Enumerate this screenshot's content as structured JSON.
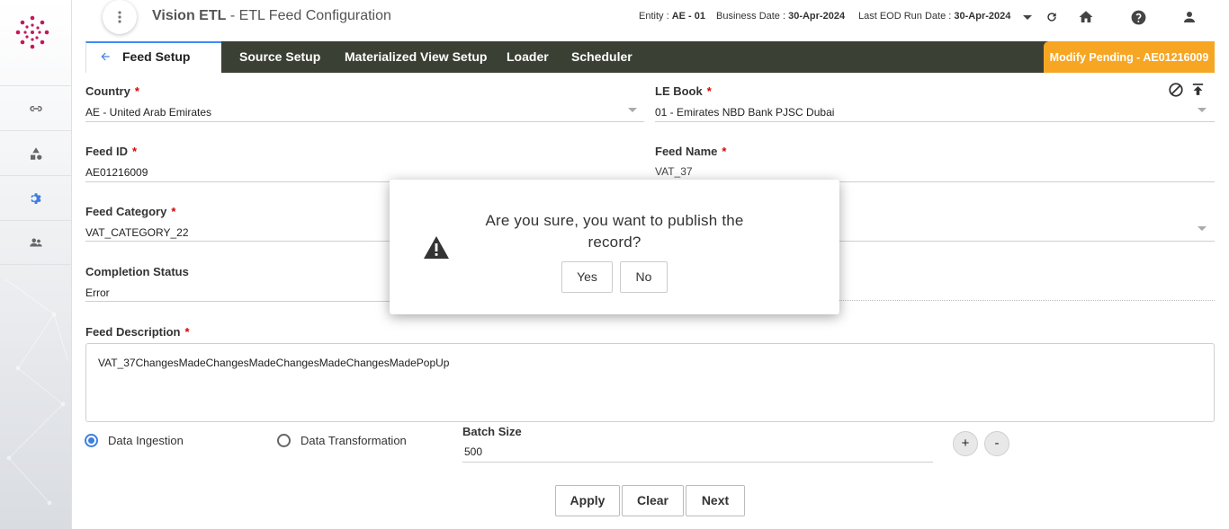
{
  "app": {
    "title_bold": "Vision ETL",
    "title_rest": " - ETL Feed Configuration"
  },
  "header": {
    "entity_label": "Entity : ",
    "entity_value": "AE - 01",
    "business_date_label": "Business Date : ",
    "business_date_value": "30-Apr-2024",
    "last_eod_label": "Last EOD Run Date : ",
    "last_eod_value": "30-Apr-2024"
  },
  "tabs": [
    {
      "label": "Feed Setup",
      "active": true
    },
    {
      "label": "Source Setup"
    },
    {
      "label": "Materialized View Setup"
    },
    {
      "label": "Loader"
    },
    {
      "label": "Scheduler"
    }
  ],
  "status_badge": "Modify Pending - AE01216009",
  "form": {
    "country": {
      "label": "Country",
      "value": "AE - United Arab Emirates"
    },
    "le_book": {
      "label": "LE Book",
      "value": "01 - Emirates NBD Bank PJSC Dubai"
    },
    "feed_id": {
      "label": "Feed ID",
      "value": "AE01216009"
    },
    "feed_name": {
      "label": "Feed Name",
      "value": "VAT_37"
    },
    "feed_category": {
      "label": "Feed Category",
      "value": "VAT_CATEGORY_22"
    },
    "completion_status": {
      "label": "Completion Status",
      "value": "Error"
    },
    "feed_description": {
      "label": "Feed Description",
      "value": "VAT_37ChangesMadeChangesMadeChangesMadeChangesMadePopUp"
    },
    "radio_ingestion": "Data Ingestion",
    "radio_transformation": "Data Transformation",
    "selected_radio": "Data Ingestion",
    "batch_size": {
      "label": "Batch Size",
      "value": "500"
    }
  },
  "buttons": {
    "plus": "+",
    "minus": "-",
    "apply": "Apply",
    "clear": "Clear",
    "next": "Next"
  },
  "dialog": {
    "message": "Are you sure, you want to publish the record?",
    "yes": "Yes",
    "no": "No"
  },
  "colors": {
    "accent": "#3d7fe0",
    "tabbar": "#3b4034",
    "pending": "#f6a623",
    "required": "#dd0000"
  }
}
